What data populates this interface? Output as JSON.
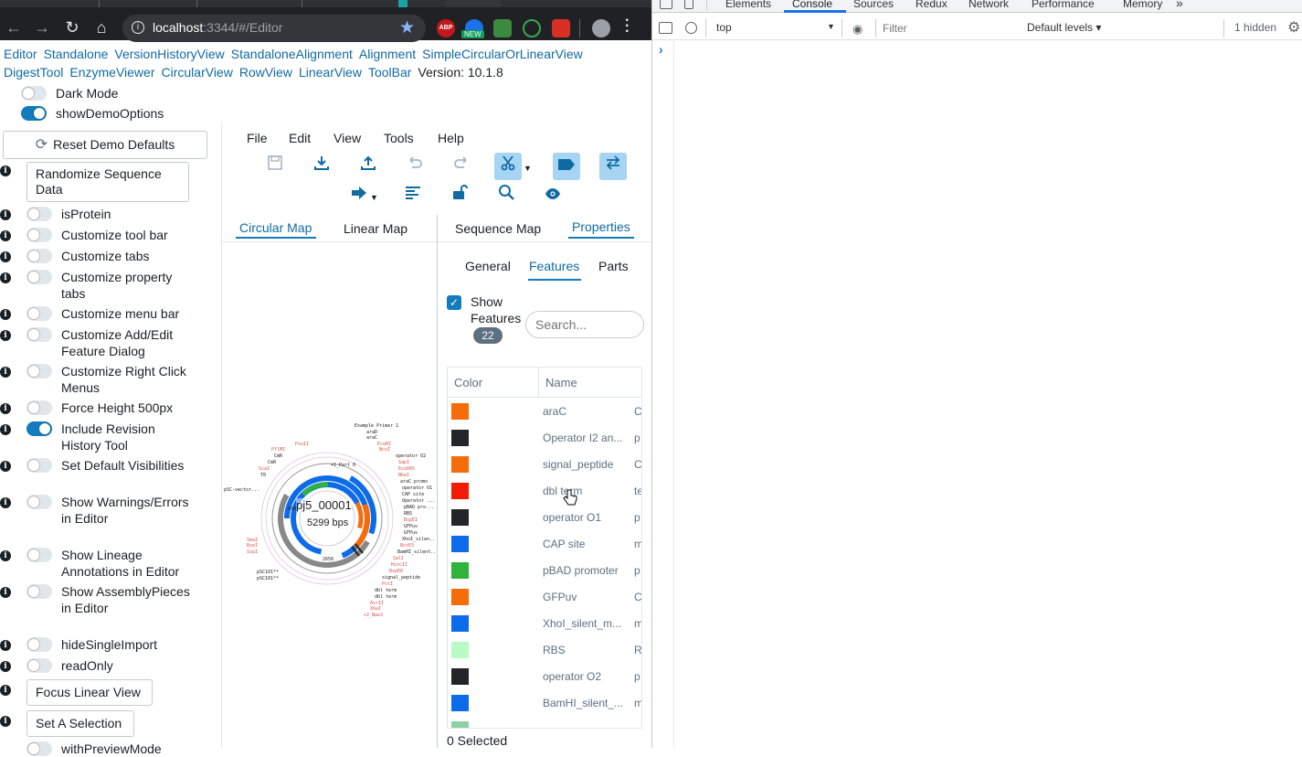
{
  "browser": {
    "url_host": "localhost",
    "url_port": ":3344",
    "url_path": "/#/Editor",
    "abp_label": "ABP",
    "new_badge": "NEW"
  },
  "nav_links": [
    "Editor",
    "Standalone",
    "VersionHistoryView",
    "StandaloneAlignment",
    "Alignment",
    "SimpleCircularOrLinearView",
    "DigestTool",
    "EnzymeViewer",
    "CircularView",
    "RowView",
    "LinearView",
    "ToolBar"
  ],
  "version": "Version: 10.1.8",
  "top_toggles": [
    {
      "label": "Dark Mode",
      "on": false
    },
    {
      "label": "showDemoOptions",
      "on": true
    }
  ],
  "reset_button": "Reset Demo Defaults",
  "randomize_button": "Randomize Sequence Data",
  "options": [
    {
      "label": "isProtein",
      "on": false
    },
    {
      "label": "Customize tool bar",
      "on": false
    },
    {
      "label": "Customize tabs",
      "on": false
    },
    {
      "label": "Customize property tabs",
      "on": false
    },
    {
      "label": "Customize menu bar",
      "on": false
    },
    {
      "label": "Customize Add/Edit Feature Dialog",
      "on": false
    },
    {
      "label": "Customize Right Click Menus",
      "on": false
    },
    {
      "label": "Force Height 500px",
      "on": false
    },
    {
      "label": "Include Revision History Tool",
      "on": true
    },
    {
      "label": "Set Default Visibilities",
      "on": false
    },
    {
      "label": "Show Warnings/Errors in Editor",
      "on": false
    },
    {
      "label": "Show Lineage Annotations in Editor",
      "on": false
    },
    {
      "label": "Show AssemblyPieces in Editor",
      "on": false
    },
    {
      "label": "hideSingleImport",
      "on": false
    },
    {
      "label": "readOnly",
      "on": false
    }
  ],
  "focus_button": "Focus Linear View",
  "selection_button": "Set A Selection",
  "last_option": "withPreviewMode",
  "menu": [
    "File",
    "Edit",
    "View",
    "Tools",
    "Help"
  ],
  "map_tabs": {
    "circular": "Circular Map",
    "linear": "Linear Map"
  },
  "right_tabs": {
    "sequence": "Sequence Map",
    "properties": "Properties"
  },
  "prop_tabs": {
    "general": "General",
    "features": "Features",
    "parts": "Parts"
  },
  "show_features": {
    "label": "Show Features",
    "count": "22",
    "checked": true
  },
  "search_placeholder": "Search...",
  "table_headers": {
    "color": "Color",
    "name": "Name"
  },
  "features": [
    {
      "name": "araC",
      "color": "#f56d0a",
      "extra": "C"
    },
    {
      "name": "Operator I2 an...",
      "color": "#222529",
      "extra": "p"
    },
    {
      "name": "signal_peptide",
      "color": "#f56d0a",
      "extra": "C"
    },
    {
      "name": "dbl term",
      "color": "#f41b06",
      "extra": "te"
    },
    {
      "name": "operator O1",
      "color": "#222529",
      "extra": "p"
    },
    {
      "name": "CAP site",
      "color": "#0c6be8",
      "extra": "m"
    },
    {
      "name": "pBAD promoter",
      "color": "#2eb43b",
      "extra": "p"
    },
    {
      "name": "GFPuv",
      "color": "#f56d0a",
      "extra": "C"
    },
    {
      "name": "XhoI_silent_m...",
      "color": "#0c6be8",
      "extra": "m"
    },
    {
      "name": "RBS",
      "color": "#b9fbc5",
      "extra": "R"
    },
    {
      "name": "operator O2",
      "color": "#222529",
      "extra": "p"
    },
    {
      "name": "BamHI_silent_...",
      "color": "#0c6be8",
      "extra": "m"
    },
    {
      "name": "",
      "color": "#8fcfa4",
      "extra": ""
    }
  ],
  "selected_text": "0 Selected",
  "map": {
    "name": "pj5_00001",
    "bps": "5299 bps"
  },
  "devtools": {
    "tabs": [
      "Elements",
      "Console",
      "Sources",
      "Redux",
      "Network",
      "Performance",
      "Memory"
    ],
    "context": "top",
    "filter_placeholder": "Filter",
    "levels": "Default levels ▾",
    "hidden": "1 hidden",
    "prompt": "›"
  }
}
